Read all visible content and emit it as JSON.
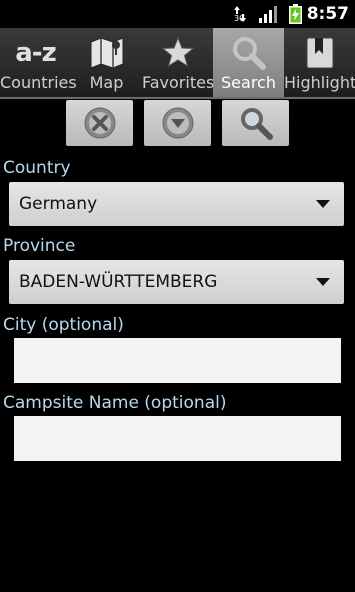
{
  "status_bar": {
    "network": "3G",
    "time": "8:57"
  },
  "tabs": [
    {
      "label": "Countries",
      "icon": "az-icon",
      "active": false
    },
    {
      "label": "Map",
      "icon": "map-icon",
      "active": false
    },
    {
      "label": "Favorites",
      "icon": "star-icon",
      "active": false
    },
    {
      "label": "Search",
      "icon": "search-icon",
      "active": true
    },
    {
      "label": "Highlights",
      "icon": "bookmark-icon",
      "active": false
    }
  ],
  "tab_icon_text": {
    "countries": "a-z"
  },
  "actions": [
    "clear",
    "expand",
    "search"
  ],
  "form": {
    "country_label": "Country",
    "country_value": "Germany",
    "province_label": "Province",
    "province_value": "BADEN-WÜRTTEMBERG",
    "city_label": "City (optional)",
    "city_value": "",
    "campsite_label": "Campsite Name (optional)",
    "campsite_value": ""
  },
  "colors": {
    "label": "#b7d9f0",
    "active_tab": "#8e8e8e",
    "background": "#000000"
  }
}
